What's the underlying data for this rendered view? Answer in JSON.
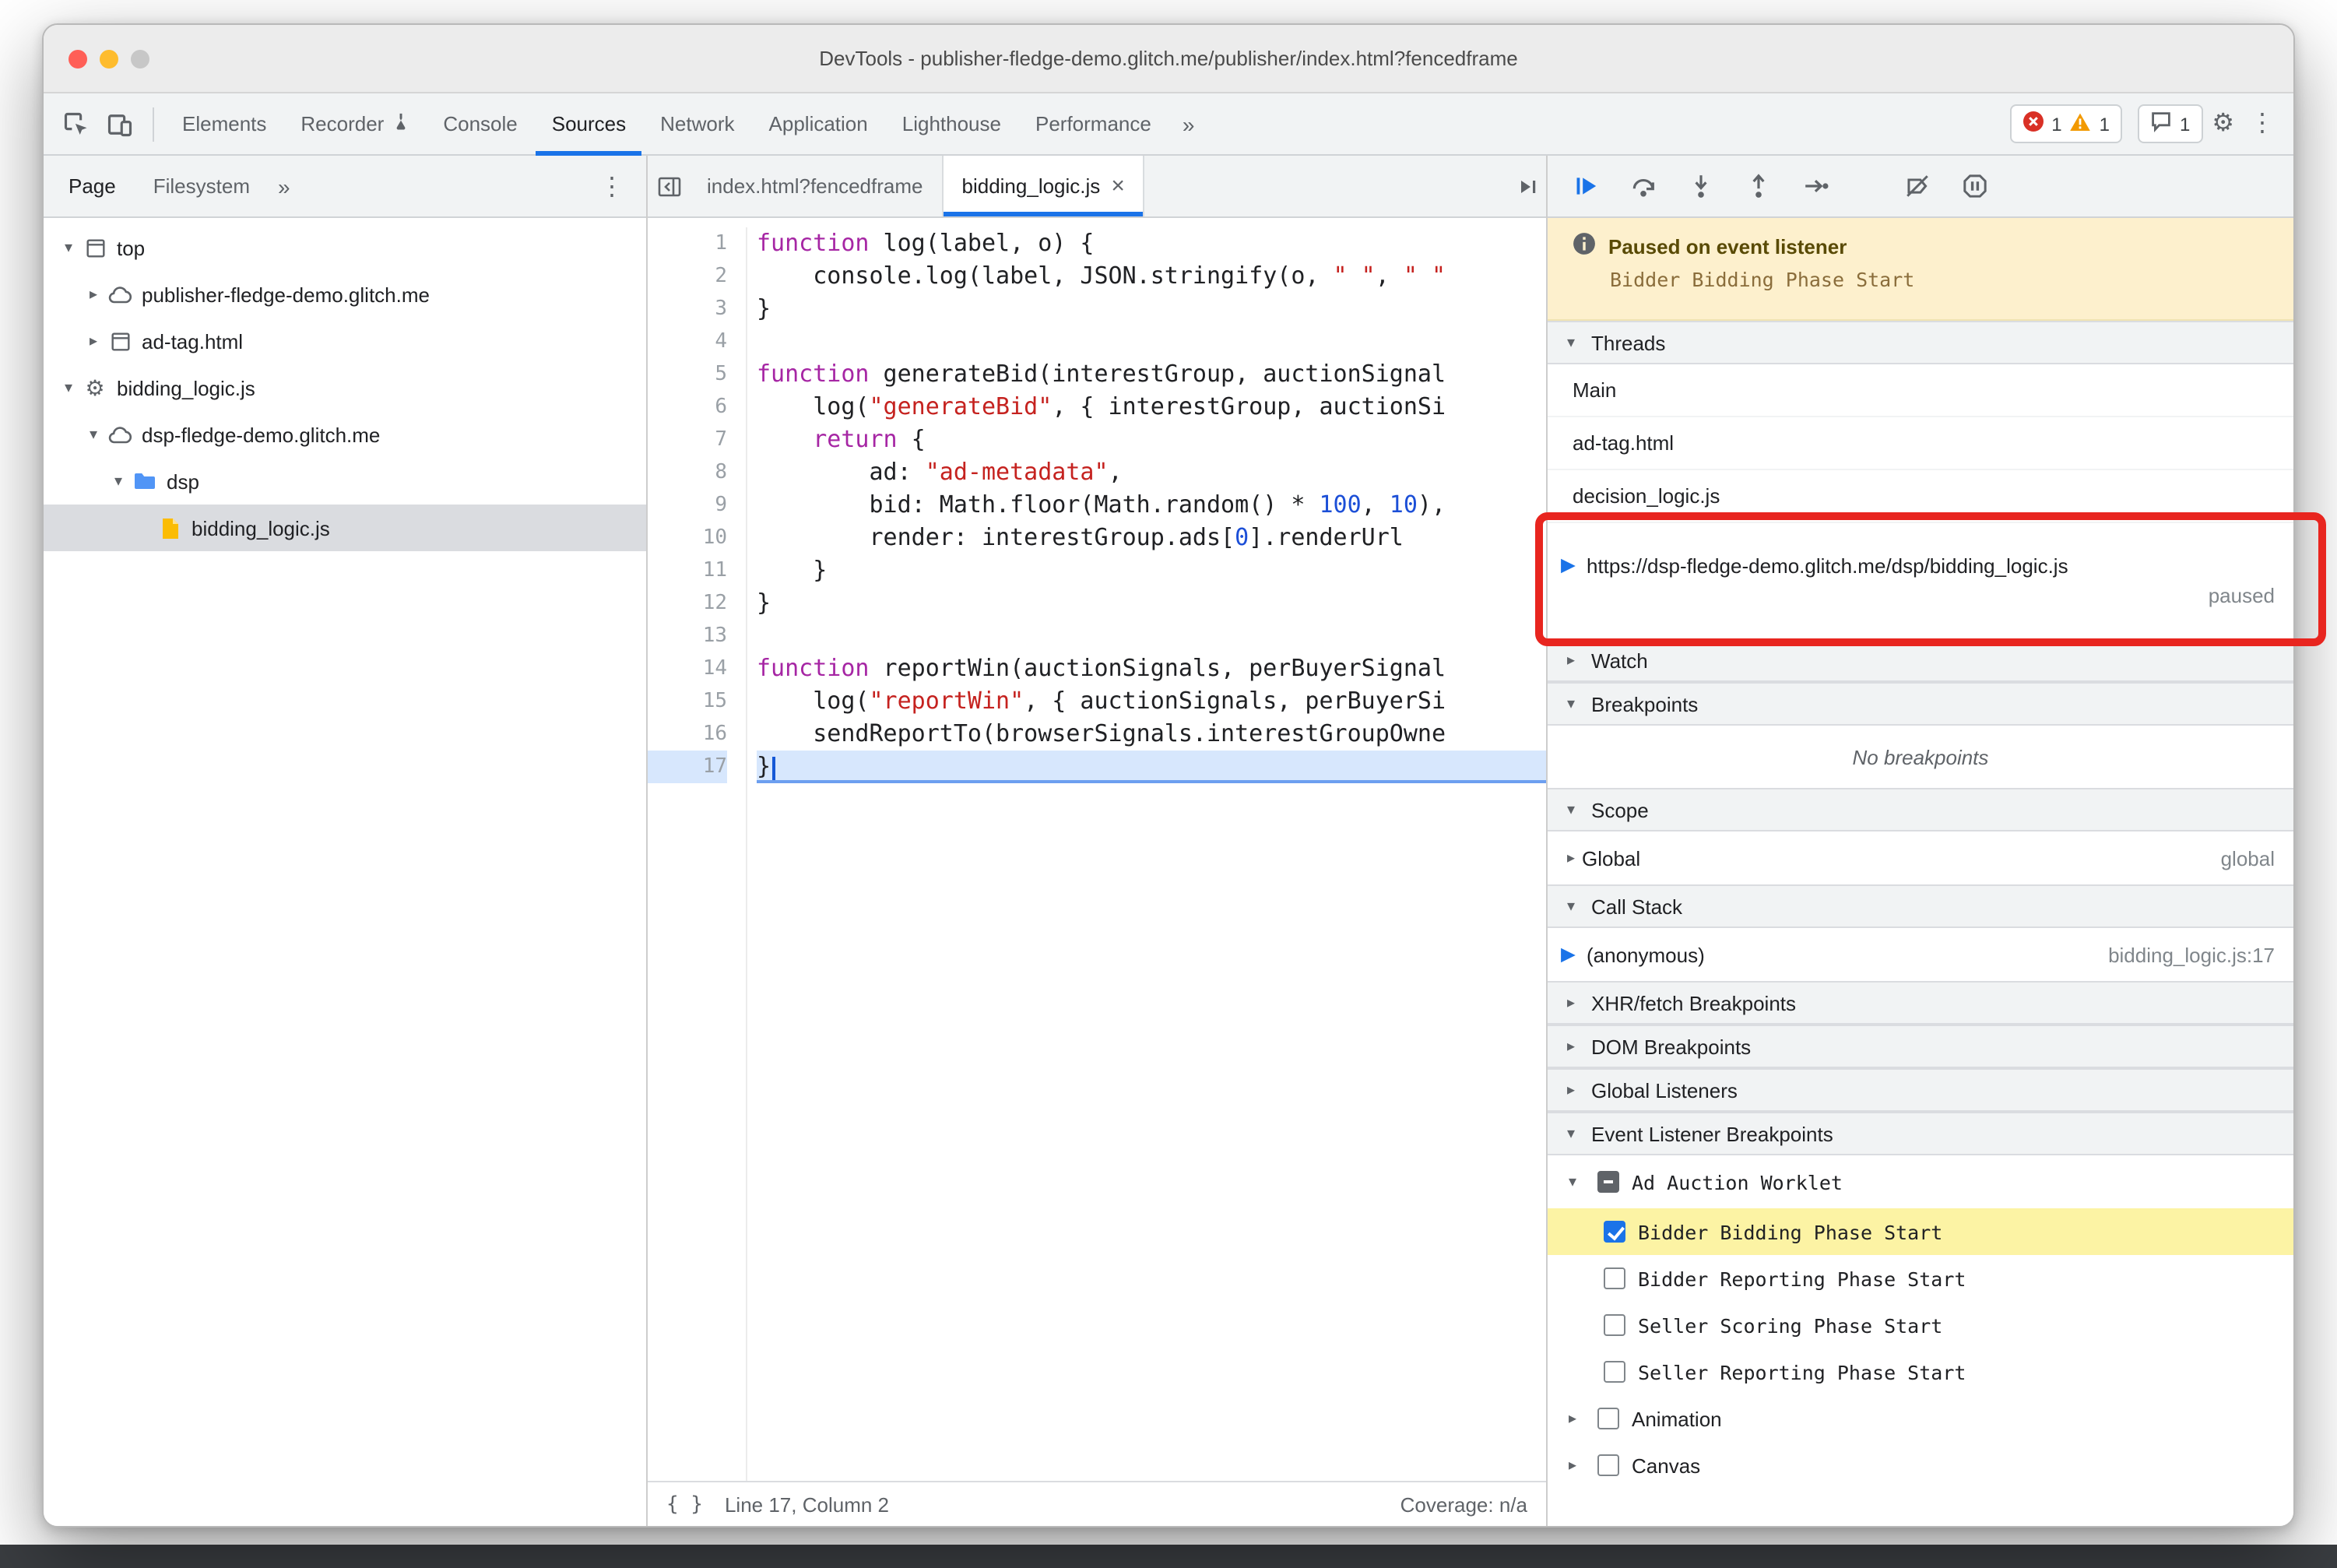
{
  "window": {
    "title": "DevTools - publisher-fledge-demo.glitch.me/publisher/index.html?fencedframe"
  },
  "icons": {
    "disclosure_open": "▾",
    "disclosure_closed": "▸",
    "chevrons": "»",
    "kebab": "⋮",
    "gear": "⚙",
    "close": "×",
    "braces": "{ }"
  },
  "toolbar": {
    "tabs": [
      {
        "label": "Elements"
      },
      {
        "label": "Recorder"
      },
      {
        "label": "Console"
      },
      {
        "label": "Sources"
      },
      {
        "label": "Network"
      },
      {
        "label": "Application"
      },
      {
        "label": "Lighthouse"
      },
      {
        "label": "Performance"
      }
    ],
    "badges": {
      "errors": "1",
      "warnings": "1",
      "issues": "1"
    }
  },
  "sidebar": {
    "tabs": [
      {
        "label": "Page"
      },
      {
        "label": "Filesystem"
      }
    ],
    "tree": [
      {
        "label": "top"
      },
      {
        "label": "publisher-fledge-demo.glitch.me"
      },
      {
        "label": "ad-tag.html"
      },
      {
        "label": "bidding_logic.js"
      },
      {
        "label": "dsp-fledge-demo.glitch.me"
      },
      {
        "label": "dsp"
      },
      {
        "label": "bidding_logic.js"
      }
    ]
  },
  "editor": {
    "tabs": [
      {
        "label": "index.html?fencedframe"
      },
      {
        "label": "bidding_logic.js"
      }
    ],
    "status": {
      "position": "Line 17, Column 2",
      "coverage": "Coverage: n/a"
    },
    "code": [
      {
        "num": 1,
        "tokens": [
          [
            "k",
            "function"
          ],
          [
            "p",
            " log(label, o) {"
          ]
        ]
      },
      {
        "num": 2,
        "tokens": [
          [
            "p",
            "    console.log(label, JSON.stringify(o, "
          ],
          [
            "s",
            "\" \""
          ],
          [
            "p",
            ", "
          ],
          [
            "s",
            "\" \""
          ]
        ]
      },
      {
        "num": 3,
        "tokens": [
          [
            "p",
            "}"
          ]
        ]
      },
      {
        "num": 4,
        "tokens": []
      },
      {
        "num": 5,
        "tokens": [
          [
            "k",
            "function"
          ],
          [
            "p",
            " generateBid(interestGroup, auctionSignal"
          ]
        ]
      },
      {
        "num": 6,
        "tokens": [
          [
            "p",
            "    log("
          ],
          [
            "s",
            "\"generateBid\""
          ],
          [
            "p",
            ", { interestGroup, auctionSi"
          ]
        ]
      },
      {
        "num": 7,
        "tokens": [
          [
            "p",
            "    "
          ],
          [
            "k",
            "return"
          ],
          [
            "p",
            " {"
          ]
        ]
      },
      {
        "num": 8,
        "tokens": [
          [
            "p",
            "        ad: "
          ],
          [
            "s",
            "\"ad-metadata\""
          ],
          [
            "p",
            ","
          ]
        ]
      },
      {
        "num": 9,
        "tokens": [
          [
            "p",
            "        bid: Math.floor(Math.random() * "
          ],
          [
            "n",
            "100"
          ],
          [
            "p",
            ", "
          ],
          [
            "n",
            "10"
          ],
          [
            "p",
            "),"
          ]
        ]
      },
      {
        "num": 10,
        "tokens": [
          [
            "p",
            "        render: interestGroup.ads["
          ],
          [
            "n",
            "0"
          ],
          [
            "p",
            "].renderUrl"
          ]
        ]
      },
      {
        "num": 11,
        "tokens": [
          [
            "p",
            "    }"
          ]
        ]
      },
      {
        "num": 12,
        "tokens": [
          [
            "p",
            "}"
          ]
        ]
      },
      {
        "num": 13,
        "tokens": []
      },
      {
        "num": 14,
        "tokens": [
          [
            "k",
            "function"
          ],
          [
            "p",
            " reportWin(auctionSignals, perBuyerSignal"
          ]
        ]
      },
      {
        "num": 15,
        "tokens": [
          [
            "p",
            "    log("
          ],
          [
            "s",
            "\"reportWin\""
          ],
          [
            "p",
            ", { auctionSignals, perBuyerSi"
          ]
        ]
      },
      {
        "num": 16,
        "tokens": [
          [
            "p",
            "    sendReportTo(browserSignals.interestGroupOwne"
          ]
        ]
      },
      {
        "num": 17,
        "tokens": [
          [
            "p",
            "}"
          ]
        ],
        "exec": true,
        "caret": true
      }
    ]
  },
  "debugger": {
    "paused": {
      "title": "Paused on event listener",
      "event": "Bidder Bidding Phase Start"
    },
    "threads": {
      "title": "Threads",
      "items": [
        "Main",
        "ad-tag.html",
        "decision_logic.js"
      ],
      "paused_thread": {
        "url": "https://dsp-fledge-demo.glitch.me/dsp/bidding_logic.js",
        "status": "paused"
      }
    },
    "watch": {
      "title": "Watch"
    },
    "breakpoints": {
      "title": "Breakpoints",
      "empty": "No breakpoints"
    },
    "scope": {
      "title": "Scope",
      "rows": [
        {
          "label": "Global",
          "value": "global"
        }
      ]
    },
    "call_stack": {
      "title": "Call Stack",
      "frames": [
        {
          "name": "(anonymous)",
          "location": "bidding_logic.js:17"
        }
      ]
    },
    "xhr": {
      "title": "XHR/fetch Breakpoints"
    },
    "dom": {
      "title": "DOM Breakpoints"
    },
    "global_listeners": {
      "title": "Global Listeners"
    },
    "event_listener_breakpoints": {
      "title": "Event Listener Breakpoints",
      "group": {
        "label": "Ad Auction Worklet"
      },
      "items": [
        {
          "label": "Bidder Bidding Phase Start",
          "checked": true,
          "highlighted": true
        },
        {
          "label": "Bidder Reporting Phase Start",
          "checked": false
        },
        {
          "label": "Seller Scoring Phase Start",
          "checked": false
        },
        {
          "label": "Seller Reporting Phase Start",
          "checked": false
        }
      ],
      "collapsed": [
        {
          "label": "Animation"
        },
        {
          "label": "Canvas"
        }
      ]
    }
  }
}
